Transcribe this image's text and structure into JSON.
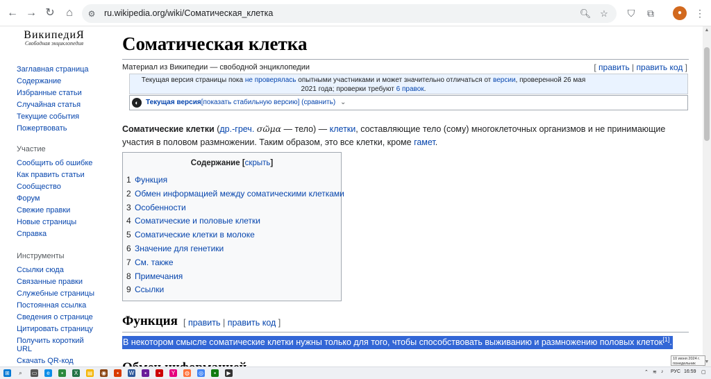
{
  "browser": {
    "url": "ru.wikipedia.org/wiki/Соматическая_клетка"
  },
  "sidebar": {
    "logo_title": "ВикипедиЯ",
    "logo_subtitle": "Свободная энциклопедия",
    "main_links": [
      "Заглавная страница",
      "Содержание",
      "Избранные статьи",
      "Случайная статья",
      "Текущие события",
      "Пожертвовать"
    ],
    "participation_heading": "Участие",
    "participation_links": [
      "Сообщить об ошибке",
      "Как править статьи",
      "Сообщество",
      "Форум",
      "Свежие правки",
      "Новые страницы",
      "Справка"
    ],
    "tools_heading": "Инструменты",
    "tools_links": [
      "Ссылки сюда",
      "Связанные правки",
      "Служебные страницы",
      "Постоянная ссылка",
      "Сведения о странице",
      "Цитировать страницу",
      "Получить короткий URL",
      "Скачать QR-код"
    ]
  },
  "article": {
    "title": "Соматическая клетка",
    "tagline": "Материал из Википедии — свободной энциклопедии",
    "edit_link": "править",
    "edit_code_link": "править код",
    "notice_part1": "Текущая версия страницы пока ",
    "notice_link1": "не проверялась",
    "notice_part2": " опытными участниками и может значительно отличаться от ",
    "notice_link2": "версии",
    "notice_part3": ", проверенной 26 мая 2021 года; проверки требуют ",
    "notice_link3": "6 правок",
    "notice_part4": ".",
    "version_current": "Текущая версия",
    "version_show_stable": "[показать стабильную версию]",
    "version_compare": "(сравнить)",
    "lead_bold": "Соматические клетки",
    "lead_paren_open": " (",
    "lead_greek_link": "др.-греч.",
    "lead_greek_word": "σῶμα",
    "lead_text1": " — тело) — ",
    "lead_cells_link": "клетки",
    "lead_text2": ", составляющие тело (сому) многоклеточных организмов и не принимающие участия в половом размножении. Таким образом, это все клетки, кроме ",
    "lead_gametes_link": "гамет",
    "lead_text3": ".",
    "toc_title": "Содержание",
    "toc_hide": "скрыть",
    "toc_items": [
      {
        "num": "1",
        "text": "Функция"
      },
      {
        "num": "2",
        "text": "Обмен информацией между соматическими клетками"
      },
      {
        "num": "3",
        "text": "Особенности"
      },
      {
        "num": "4",
        "text": "Соматические и половые клетки"
      },
      {
        "num": "5",
        "text": "Соматические клетки в молоке"
      },
      {
        "num": "6",
        "text": "Значение для генетики"
      },
      {
        "num": "7",
        "text": "См. также"
      },
      {
        "num": "8",
        "text": "Примечания"
      },
      {
        "num": "9",
        "text": "Ссылки"
      }
    ],
    "section1_title": "Функция",
    "section1_selected_text": "В некотором смысле соматические клетки нужны только для того, чтобы способствовать выживанию и размножению половых клеток",
    "section1_ref": "[1]",
    "section1_after_ref": ".",
    "next_section_partial": "Обмен информацией"
  },
  "taskbar": {
    "language": "РУС",
    "time": "16:59",
    "tooltip_date": "10 июня 2024 г.",
    "tooltip_day": "понедельник"
  },
  "colors": {
    "link": "#0645ad",
    "selection": "#3367d6",
    "notice_bg": "#eaf3ff"
  }
}
